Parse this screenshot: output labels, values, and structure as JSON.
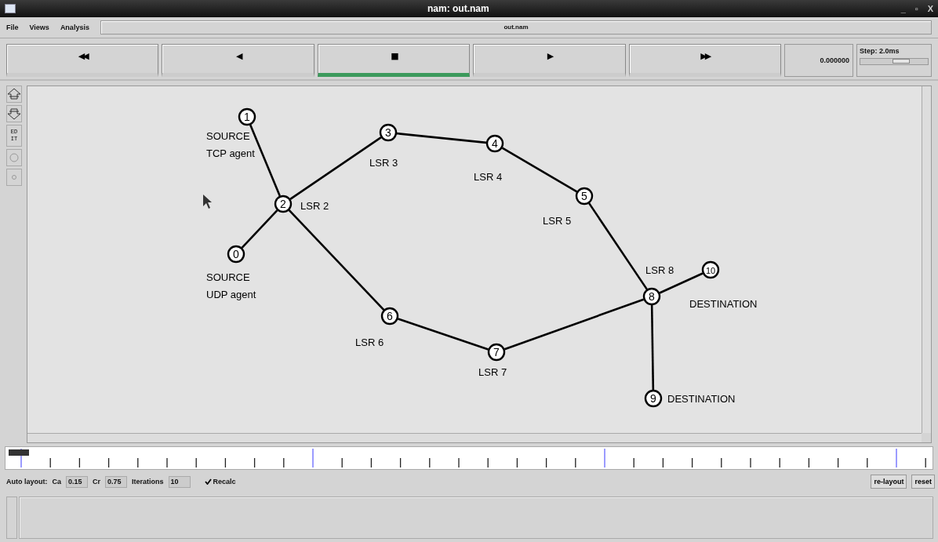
{
  "window": {
    "title": "nam: out.nam",
    "controls": [
      "_",
      "▫",
      "X"
    ]
  },
  "menu": [
    "File",
    "Views",
    "Analysis"
  ],
  "file_field": {
    "value": "out.nam"
  },
  "playback": [
    {
      "glyph": "◀◀",
      "selected": false
    },
    {
      "glyph": "◀",
      "selected": false
    },
    {
      "glyph": "■",
      "selected": true
    },
    {
      "glyph": "▶",
      "selected": false
    },
    {
      "glyph": "▶▶",
      "selected": false
    }
  ],
  "time": "0.000000",
  "step": {
    "label": "Step: 2.0ms",
    "level": 0.6
  },
  "tools": [
    {
      "kind": "zoom-in"
    },
    {
      "kind": "zoom-out"
    },
    {
      "kind": "text",
      "label": "ED IT"
    },
    {
      "kind": "circle"
    },
    {
      "kind": "dot"
    }
  ],
  "graph": {
    "nodes": [
      "0",
      "1",
      "2",
      "3",
      "4",
      "5",
      "6",
      "7",
      "8",
      "9",
      "10"
    ],
    "labels": [
      "SOURCE",
      "TCP agent",
      "LSR 2",
      "LSR 3",
      "LSR 4",
      "LSR 5",
      "SOURCE",
      "UDP agent",
      "LSR 6",
      "LSR 7",
      "LSR 8",
      "DESTINATION",
      "DESTINATION"
    ]
  },
  "auto_layout": {
    "label": "Auto layout:",
    "fields": [
      {
        "label": "Ca",
        "value": "0.15"
      },
      {
        "label": "Cr",
        "value": "0.75"
      },
      {
        "label": "Iterations",
        "value": "10"
      }
    ],
    "recalc": {
      "label": "Recalc",
      "checked": true
    }
  },
  "buttons": [
    "re-layout",
    "reset"
  ]
}
